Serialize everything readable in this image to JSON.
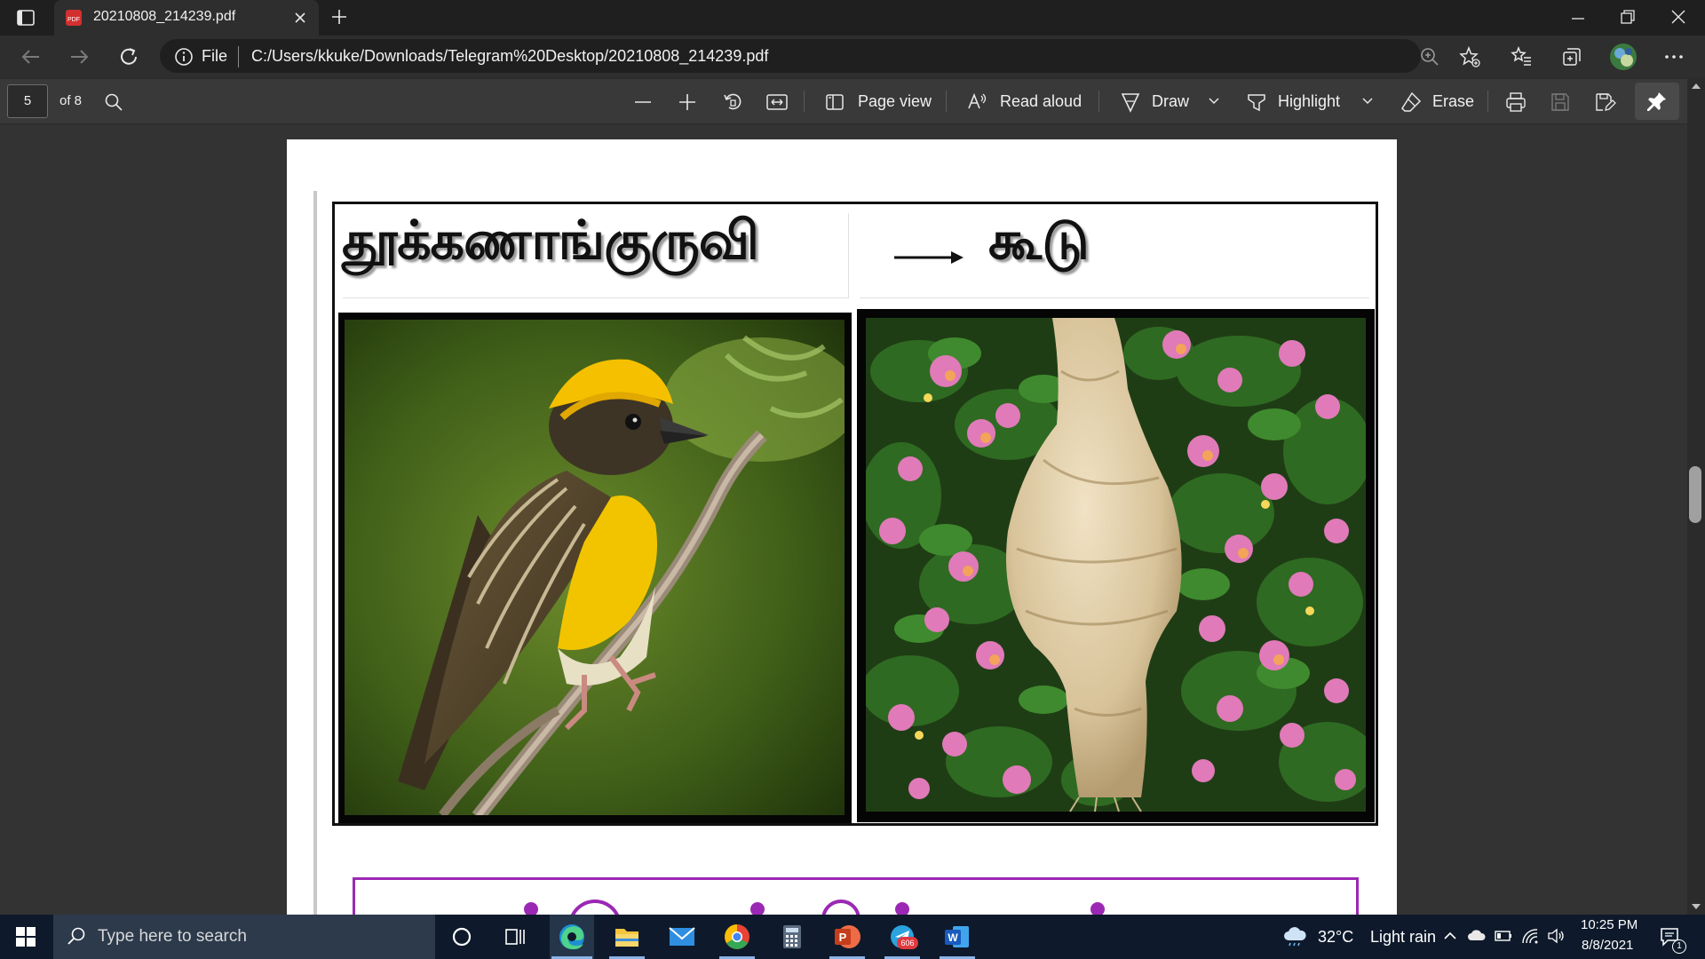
{
  "browser": {
    "tab_title": "20210808_214239.pdf",
    "tab_icon": "pdf-file-icon",
    "address_scheme": "File",
    "address_url": "C:/Users/kkuke/Downloads/Telegram%20Desktop/20210808_214239.pdf"
  },
  "pdf_toolbar": {
    "page_number": "5",
    "page_total": "of 8",
    "page_view_label": "Page view",
    "read_aloud_label": "Read aloud",
    "draw_label": "Draw",
    "highlight_label": "Highlight",
    "erase_label": "Erase"
  },
  "document": {
    "heading_left": "தூக்கணாங்குருவி",
    "heading_right": "கூடு",
    "image_left": "weaver-bird-photo",
    "image_right": "hanging-nest-photo"
  },
  "taskbar": {
    "search_placeholder": "Type here to search",
    "telegram_badge": "606",
    "weather_temp": "32°C",
    "weather_text": "Light rain",
    "time": "10:25 PM",
    "date": "8/8/2021",
    "notification_count": "1"
  },
  "colors": {
    "accent": "#8ab4e8",
    "page_bg": "#ffffff",
    "viewer_bg": "#333333",
    "frame_purple": "#9b28b4"
  }
}
